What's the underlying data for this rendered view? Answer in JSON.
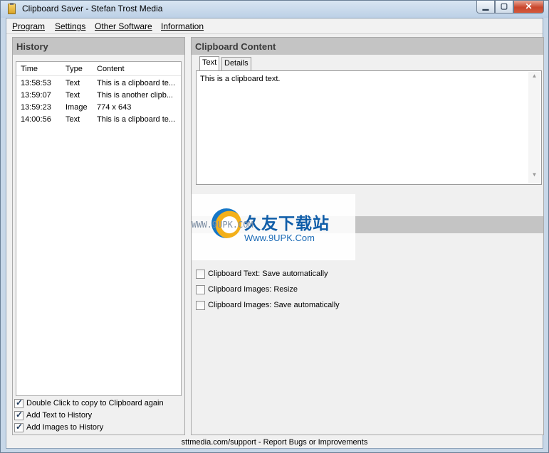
{
  "window": {
    "title": "Clipboard Saver - Stefan Trost Media"
  },
  "menu": [
    "Program",
    "Settings",
    "Other Software",
    "Information"
  ],
  "history": {
    "title": "History",
    "columns": [
      "Time",
      "Type",
      "Content"
    ],
    "rows": [
      {
        "time": "13:58:53",
        "type": "Text",
        "content": "This is a clipboard te..."
      },
      {
        "time": "13:59:07",
        "type": "Text",
        "content": "This is another clipb..."
      },
      {
        "time": "13:59:23",
        "type": "Image",
        "content": "774 x 643"
      },
      {
        "time": "14:00:56",
        "type": "Text",
        "content": "This is a clipboard te..."
      }
    ],
    "options": [
      {
        "label": "Double Click to copy to Clipboard again",
        "checked": true
      },
      {
        "label": "Add Text to History",
        "checked": true
      },
      {
        "label": "Add Images to History",
        "checked": true
      }
    ]
  },
  "clipboard": {
    "title": "Clipboard Content",
    "tabs": [
      "Text",
      "Details"
    ],
    "active_tab": "Text",
    "text": "This is a clipboard text."
  },
  "settings": {
    "options": [
      {
        "label": "Clipboard Text: Save automatically",
        "checked": false
      },
      {
        "label": "Clipboard Images: Resize",
        "checked": false
      },
      {
        "label": "Clipboard Images: Save automatically",
        "checked": false
      }
    ]
  },
  "status": "sttmedia.com/support - Report Bugs or Improvements",
  "watermark": {
    "title": "久友下载站",
    "url": "Www.9UPK.Com",
    "side_text": "WWW.9UPK.COM"
  }
}
